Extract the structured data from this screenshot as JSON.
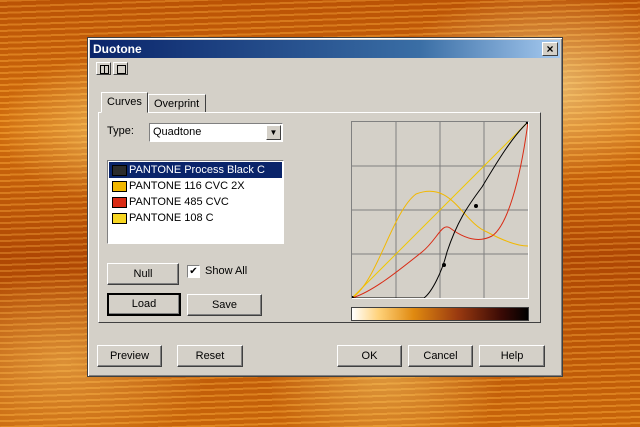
{
  "dialog": {
    "title": "Duotone",
    "close_glyph": "×"
  },
  "tabs": [
    {
      "label": "Curves",
      "active": true
    },
    {
      "label": "Overprint",
      "active": false
    }
  ],
  "type_selector": {
    "label": "Type:",
    "value": "Quadtone"
  },
  "inks": [
    {
      "name": "PANTONE Process Black C",
      "color": "#2b2b2b",
      "selected": true
    },
    {
      "name": "PANTONE 116 CVC 2X",
      "color": "#f2b800",
      "selected": false
    },
    {
      "name": "PANTONE 485 CVC",
      "color": "#d92a14",
      "selected": false
    },
    {
      "name": "PANTONE 108 C",
      "color": "#f7d622",
      "selected": false
    }
  ],
  "buttons": {
    "null": "Null",
    "show_all": "Show All",
    "show_all_checked": true,
    "load": "Load",
    "save": "Save",
    "preview": "Preview",
    "reset": "Reset",
    "ok": "OK",
    "cancel": "Cancel",
    "help": "Help"
  },
  "colors": {
    "title_bar": "#0a246a",
    "selection": "#0a246a",
    "dialog_face": "#d4d0c8"
  }
}
